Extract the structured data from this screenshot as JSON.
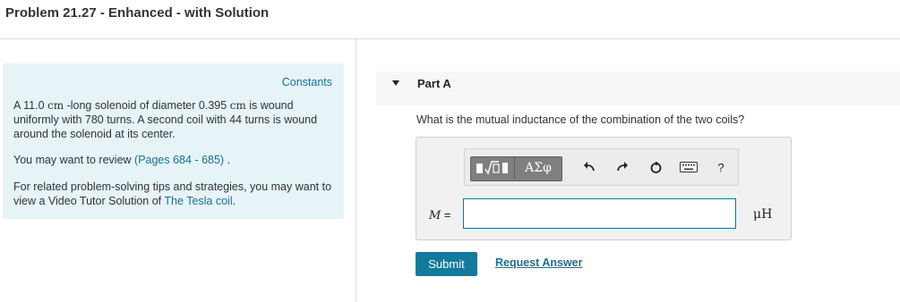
{
  "header": {
    "title": "Problem 21.27 - Enhanced - with Solution"
  },
  "left": {
    "constants_link": "Constants",
    "p1_a": "A 11.0 ",
    "p1_unit1": "cm",
    "p1_b": " -long solenoid of diameter 0.395 ",
    "p1_unit2": "cm",
    "p1_c": " is wound uniformly with 780 turns. A second coil with 44 turns is wound around the solenoid at its center.",
    "p2_text": "You may want to review ",
    "p2_link": "(Pages 684 - 685)",
    "p2_end": " .",
    "p3_text": "For related problem-solving tips and strategies, you may want to view a Video Tutor Solution of ",
    "p3_link": "The Tesla coil",
    "p3_end": "."
  },
  "part": {
    "label": "Part A",
    "question": "What is the mutual inductance of the combination of the two coils?",
    "toolbar": {
      "template_label": "▮√▯",
      "greek_label": "ΑΣφ",
      "undo_icon": "undo-arrow",
      "redo_icon": "redo-arrow",
      "reset_icon": "reset-circle",
      "keyboard_icon": "keyboard",
      "help_label": "?"
    },
    "variable": "M",
    "equals": " =",
    "input_value": "",
    "unit": "μH",
    "submit_label": "Submit",
    "request_label": "Request Answer"
  }
}
